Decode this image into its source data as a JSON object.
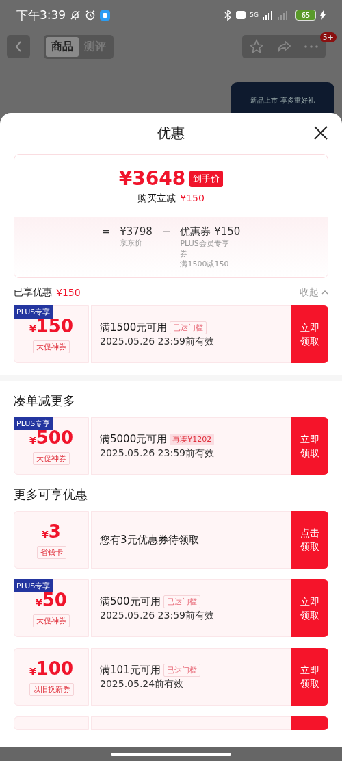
{
  "status_bar": {
    "time": "下午3:39",
    "network": "5G",
    "battery": "65"
  },
  "nav": {
    "tabs": [
      {
        "label": "商品",
        "selected": true
      },
      {
        "label": "测评",
        "selected": false
      }
    ],
    "badge": "5+"
  },
  "background": {
    "banner": "新品上市 享多重好礼"
  },
  "sheet": {
    "title": "优惠",
    "summary": {
      "price": "¥3648",
      "price_tag": "到手价",
      "saving_label": "购买立减",
      "saving_amount": "¥150",
      "equals": "=",
      "minus": "−",
      "base": {
        "amount": "¥3798",
        "label": "京东价"
      },
      "discount": {
        "amount": "优惠券 ¥150",
        "lines": [
          "PLUS会员专享券",
          "满1500减150"
        ]
      }
    },
    "applied": {
      "label": "已享优惠",
      "amount": "¥150",
      "toggle": "收起"
    },
    "sections": [
      {
        "coupons": [
          {
            "kind": "coupon",
            "tag": "PLUS专享",
            "currency": "¥",
            "amount": "150",
            "category": "大促神券",
            "condition": "满1500元可用",
            "badge": {
              "kind": "reached",
              "text": "已达门槛"
            },
            "validity": "2025.05.26 23:59前有效",
            "action": "立即领取"
          }
        ]
      },
      {
        "title": "凑单减更多",
        "coupons": [
          {
            "kind": "coupon",
            "tag": "PLUS专享",
            "currency": "¥",
            "amount": "500",
            "category": "大促神券",
            "condition": "满5000元可用",
            "badge": {
              "kind": "more",
              "text": "再凑¥1202"
            },
            "validity": "2025.05.26 23:59前有效",
            "action": "立即领取"
          }
        ]
      },
      {
        "title": "更多可享优惠",
        "coupons": [
          {
            "kind": "card",
            "currency": "¥",
            "amount": "3",
            "category": "省钱卡",
            "condition": "您有3元优惠券待领取",
            "action": "点击领取"
          },
          {
            "kind": "coupon",
            "tag": "PLUS专享",
            "currency": "¥",
            "amount": "50",
            "category": "大促神券",
            "condition": "满500元可用",
            "badge": {
              "kind": "reached",
              "text": "已达门槛"
            },
            "validity": "2025.05.26 23:59前有效",
            "action": "立即领取"
          },
          {
            "kind": "coupon",
            "currency": "¥",
            "amount": "100",
            "category": "以旧换新券",
            "condition": "满101元可用",
            "badge": {
              "kind": "reached",
              "text": "已达门槛"
            },
            "validity": "2025.05.24前有效",
            "action": "立即领取"
          },
          {
            "kind": "cutoff"
          }
        ]
      }
    ]
  }
}
